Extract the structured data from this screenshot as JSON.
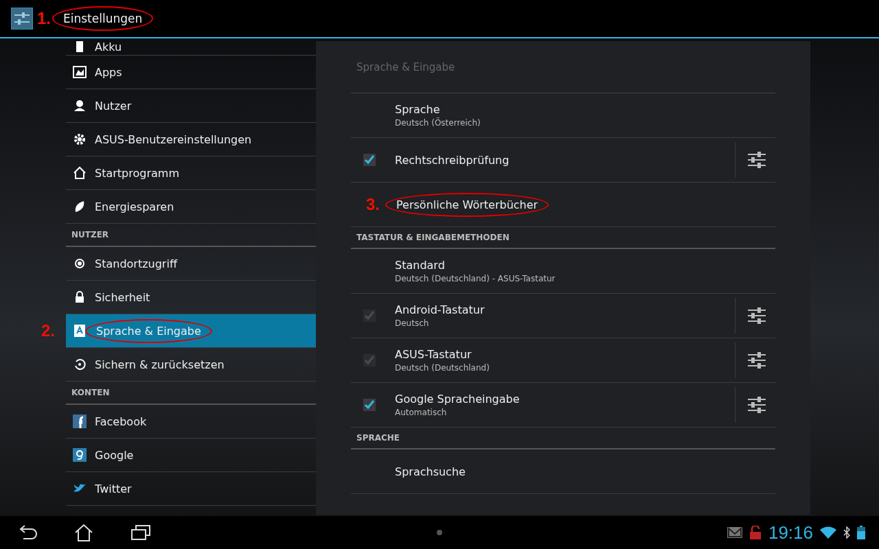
{
  "action_bar": {
    "title": "Einstellungen",
    "annotation": "1."
  },
  "sidebar": {
    "items": [
      {
        "kind": "item",
        "label": "Akku",
        "selected": false
      },
      {
        "kind": "item",
        "label": "Apps",
        "selected": false
      },
      {
        "kind": "item",
        "label": "Nutzer",
        "selected": false
      },
      {
        "kind": "item",
        "label": "ASUS-Benutzereinstellungen",
        "selected": false
      },
      {
        "kind": "item",
        "label": "Startprogramm",
        "selected": false
      },
      {
        "kind": "item",
        "label": "Energiesparen",
        "selected": false
      },
      {
        "kind": "header",
        "label": "NUTZER"
      },
      {
        "kind": "item",
        "label": "Standortzugriff",
        "selected": false
      },
      {
        "kind": "item",
        "label": "Sicherheit",
        "selected": false
      },
      {
        "kind": "item",
        "label": "Sprache & Eingabe",
        "selected": true,
        "annotation": "2."
      },
      {
        "kind": "item",
        "label": "Sichern & zurücksetzen",
        "selected": false
      },
      {
        "kind": "header",
        "label": "KONTEN"
      },
      {
        "kind": "item",
        "label": "Facebook",
        "selected": false
      },
      {
        "kind": "item",
        "label": "Google",
        "selected": false
      },
      {
        "kind": "item",
        "label": "Twitter",
        "selected": false
      }
    ]
  },
  "panel": {
    "title": "Sprache & Eingabe",
    "rows": [
      {
        "kind": "item",
        "title": "Sprache",
        "subtitle": "Deutsch (Österreich)"
      },
      {
        "kind": "check",
        "title": "Rechtschreibprüfung",
        "checked": true,
        "disabled": false
      },
      {
        "kind": "item",
        "title": "Persönliche Wörterbücher",
        "annotation": "3."
      },
      {
        "kind": "header",
        "title": "TASTATUR & EINGABEMETHODEN"
      },
      {
        "kind": "item",
        "title": "Standard",
        "subtitle": "Deutsch (Deutschland) - ASUS-Tastatur"
      },
      {
        "kind": "check",
        "title": "Android-Tastatur",
        "subtitle": "Deutsch",
        "checked": true,
        "disabled": true
      },
      {
        "kind": "check",
        "title": "ASUS-Tastatur",
        "subtitle": "Deutsch (Deutschland)",
        "checked": true,
        "disabled": true
      },
      {
        "kind": "check",
        "title": "Google Spracheingabe",
        "subtitle": "Automatisch",
        "checked": true,
        "disabled": false
      },
      {
        "kind": "header",
        "title": "SPRACHE"
      },
      {
        "kind": "item",
        "title": "Sprachsuche"
      }
    ]
  },
  "status_bar": {
    "time": "19:16"
  }
}
